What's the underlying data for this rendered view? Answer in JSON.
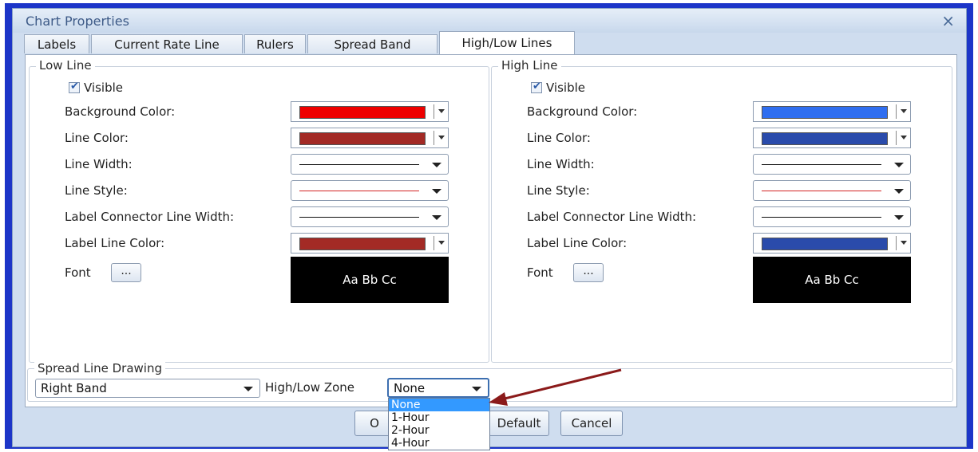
{
  "window": {
    "title": "Chart Properties",
    "close_glyph": "×"
  },
  "tabs": [
    {
      "label": "Labels"
    },
    {
      "label": "Current Rate Line"
    },
    {
      "label": "Rulers"
    },
    {
      "label": "Spread Band"
    },
    {
      "label": "High/Low Lines",
      "active": true
    }
  ],
  "low_line": {
    "group_title": "Low Line",
    "visible_label": "Visible",
    "visible_checked": true,
    "background_color_label": "Background Color:",
    "background_color": "#ee0000",
    "line_color_label": "Line Color:",
    "line_color": "#a32a25",
    "line_width_label": "Line Width:",
    "line_style_label": "Line Style:",
    "connector_width_label": "Label Connector Line Width:",
    "label_line_color_label": "Label Line Color:",
    "label_line_color": "#a32a25",
    "font_label": "Font",
    "font_button": "...",
    "font_preview": "Aa Bb Cc"
  },
  "high_line": {
    "group_title": "High Line",
    "visible_label": "Visible",
    "visible_checked": true,
    "background_color_label": "Background Color:",
    "background_color": "#2f6ef0",
    "line_color_label": "Line Color:",
    "line_color": "#2a4bab",
    "line_width_label": "Line Width:",
    "line_style_label": "Line Style:",
    "connector_width_label": "Label Connector Line Width:",
    "label_line_color_label": "Label Line Color:",
    "label_line_color": "#2a4bab",
    "font_label": "Font",
    "font_button": "...",
    "font_preview": "Aa Bb Cc"
  },
  "spread": {
    "group_title": "Spread Line Drawing",
    "band_value": "Right Band",
    "zone_label": "High/Low Zone",
    "zone_value": "None",
    "zone_options": [
      "None",
      "1-Hour",
      "2-Hour",
      "4-Hour"
    ]
  },
  "buttons": {
    "ok": "O",
    "default": "Default",
    "cancel": "Cancel"
  },
  "colors": {
    "frame": "#1c35c8",
    "annotation_arrow": "#8b1a1a",
    "selection": "#3399ff"
  }
}
